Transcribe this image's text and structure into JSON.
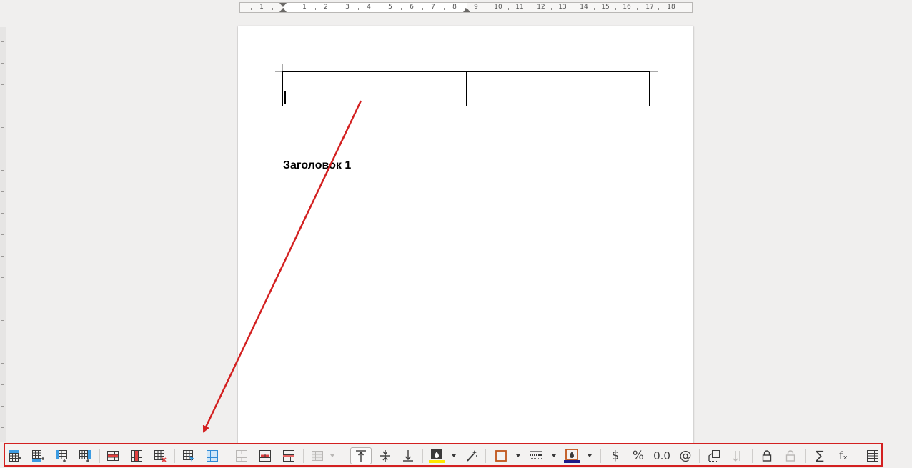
{
  "ruler": {
    "numbers": [
      "1",
      "1",
      "2",
      "3",
      "4",
      "5",
      "6",
      "7",
      "8",
      "9",
      "10",
      "11",
      "12",
      "13",
      "14",
      "15",
      "16",
      "17",
      "18"
    ]
  },
  "document": {
    "table_rows": [
      [
        "",
        ""
      ],
      [
        "",
        ""
      ]
    ],
    "heading": "Заголовок 1"
  },
  "annotation": {
    "color": "#d32020"
  },
  "toolbar": {
    "border_color": "#d32020",
    "fill_color_swatch": "#ffe800",
    "border_color_swatch": "#1c1c88",
    "buttons": [
      {
        "name": "insert-rows-above-icon"
      },
      {
        "name": "insert-rows-below-icon"
      },
      {
        "name": "insert-columns-before-icon"
      },
      {
        "name": "insert-columns-after-icon"
      },
      {
        "name": "delete-rows-icon"
      },
      {
        "name": "delete-columns-icon"
      },
      {
        "name": "delete-table-icon"
      },
      {
        "name": "select-cell-icon"
      },
      {
        "name": "select-table-icon"
      },
      {
        "name": "merge-cells-icon"
      },
      {
        "name": "split-cells-icon"
      },
      {
        "name": "split-table-icon"
      },
      {
        "name": "optimize-size-icon"
      },
      {
        "name": "align-top-icon"
      },
      {
        "name": "center-vertically-icon"
      },
      {
        "name": "align-bottom-icon"
      },
      {
        "name": "table-cell-background-color-icon"
      },
      {
        "name": "autoformat-styles-icon"
      },
      {
        "name": "borders-icon"
      },
      {
        "name": "border-style-icon"
      },
      {
        "name": "border-color-icon"
      },
      {
        "name": "number-format-currency-icon"
      },
      {
        "name": "number-format-percent-icon"
      },
      {
        "name": "number-format-decimal-icon"
      },
      {
        "name": "number-format-date-icon"
      },
      {
        "name": "insert-caption-icon"
      },
      {
        "name": "sort-icon"
      },
      {
        "name": "protect-cells-icon"
      },
      {
        "name": "unprotect-cells-icon"
      },
      {
        "name": "sum-icon"
      },
      {
        "name": "formula-icon"
      },
      {
        "name": "table-properties-icon"
      }
    ],
    "glyphs": {
      "currency": "$",
      "percent": "%",
      "decimal": "0.0",
      "date": "@",
      "sum": "∑",
      "formula": "fₓ"
    }
  }
}
